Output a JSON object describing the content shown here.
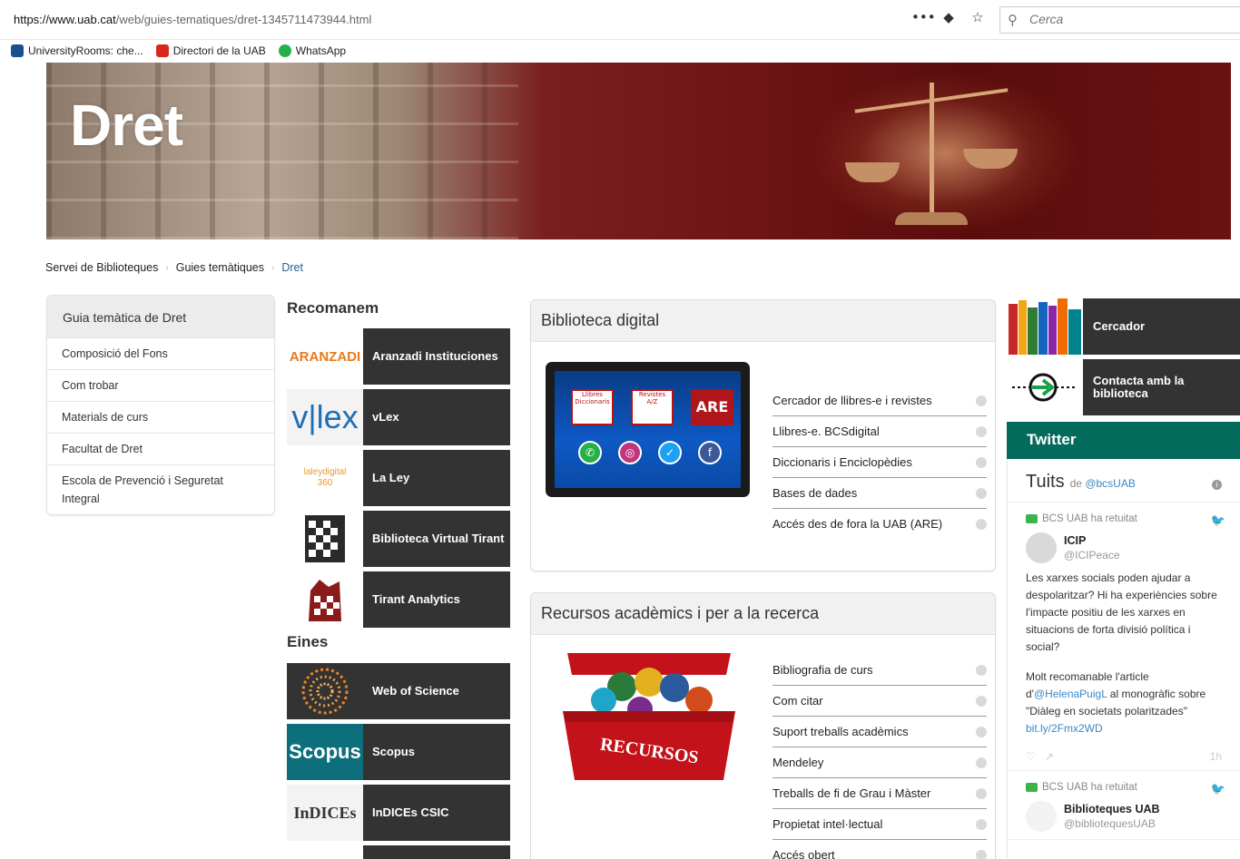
{
  "browser": {
    "url_host": "https://www.uab.cat",
    "url_path": "/web/guies-tematiques/dret-1345711473944.html",
    "search_placeholder": "Cerca",
    "actions": [
      "•••",
      "◆",
      "☆"
    ],
    "bookmarks": [
      {
        "label": "UniversityRooms: che...",
        "color": "#1c4f8f"
      },
      {
        "label": "Directori de la UAB",
        "color": "#d8261f"
      },
      {
        "label": "WhatsApp",
        "color": "#25b04a"
      }
    ]
  },
  "banner": {
    "title": "Dret"
  },
  "breadcrumb": {
    "items": [
      "Servei de Biblioteques",
      "Guies temàtiques"
    ],
    "current": "Dret"
  },
  "leftnav": {
    "title": "Guia temàtica de Dret",
    "items": [
      "Composició del Fons",
      "Com trobar",
      "Materials de curs",
      "Facultat de Dret",
      "Escola de Prevenció i Seguretat Integral"
    ]
  },
  "recomanem": {
    "title": "Recomanem",
    "items": [
      {
        "label": "Aranzadi Instituciones",
        "logo": "ARANZADI"
      },
      {
        "label": "vLex",
        "logo": "v|lex"
      },
      {
        "label": "La Ley",
        "logo": "laleydigital 360"
      },
      {
        "label": "Biblioteca Virtual Tirant",
        "logo": "tirant"
      },
      {
        "label": "Tirant Analytics",
        "logo": "tirant"
      }
    ]
  },
  "eines": {
    "title": "Eines",
    "items": [
      {
        "label": "Web of Science"
      },
      {
        "label": "Scopus",
        "logo": "Scopus"
      },
      {
        "label": "InDICEs CSIC",
        "logo": "InDICEs"
      }
    ]
  },
  "biblioteca_digital": {
    "title": "Biblioteca digital",
    "links": [
      "Cercador de llibres-e i revistes",
      "Llibres-e. BCSdigital",
      "Diccionaris i Enciclopèdies",
      "Bases de dades",
      "Accés des de fora la UAB (ARE)"
    ],
    "tiles": [
      "Llibres Diccionaris",
      "Revistes A/Z",
      "ARE"
    ]
  },
  "recursos": {
    "title": "Recursos acadèmics i per a la recerca",
    "links": [
      "Bibliografia de curs",
      "Com citar",
      "Suport treballs acadèmics",
      "Mendeley",
      "Treballs de fi de Grau i Màster",
      "Propietat intel·lectual",
      "Accés obert"
    ],
    "box_label": "RECURSOS"
  },
  "right": {
    "cercador": "Cercador",
    "contacta": "Contacta amb la biblioteca",
    "twitter": "Twitter"
  },
  "tweets": {
    "header": "Tuits",
    "by_prefix": "de",
    "by_handle": "@bcsUAB",
    "items": [
      {
        "retweet": "BCS UAB ha retuitat",
        "name": "ICIP",
        "handle": "@ICIPeace",
        "text1": "Les xarxes socials poden ajudar a despolaritzar? Hi ha experiències sobre l'impacte positiu de les xarxes en situacions de forta divisió política i social?",
        "text2_pre": "Molt recomanable l'article d'",
        "text2_mention": "@HelenaPuigL",
        "text2_post": " al monogràfic sobre \"Diàleg en societats polaritzades\"",
        "text2_link": "bit.ly/2Fmx2WD",
        "time": "1h"
      },
      {
        "retweet": "BCS UAB ha retuitat",
        "name": "Biblioteques UAB",
        "handle": "@bibliotequesUAB"
      }
    ]
  }
}
